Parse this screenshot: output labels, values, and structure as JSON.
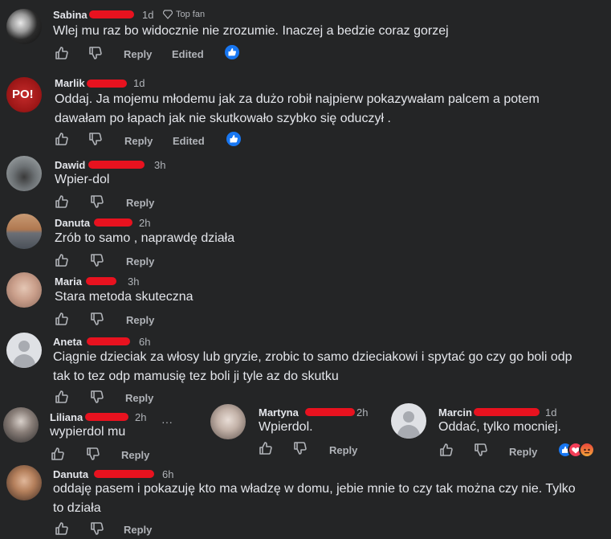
{
  "actions": {
    "reply": "Reply",
    "edited": "Edited",
    "top_fan": "Top fan"
  },
  "comments": [
    {
      "name": "Sabina",
      "time": "1d",
      "text": "Wlej mu raz bo widocznie nie zrozumie. Inaczej a bedzie coraz gorzej"
    },
    {
      "name": "Marlik",
      "time": "1d",
      "text": "Oddaj. Ja mojemu młodemu jak za dużo robił najpierw pokazywałam palcem a potem dawałam po łapach jak nie skutkowało szybko się oduczył ."
    },
    {
      "name": "Dawid",
      "time": "3h",
      "text": "Wpier-dol"
    },
    {
      "name": "Danuta",
      "time": "2h",
      "text": "Zrób to samo , naprawdę działa"
    },
    {
      "name": "Maria",
      "time": "3h",
      "text": "Stara metoda skuteczna"
    },
    {
      "name": "Aneta",
      "time": "6h",
      "text": "Ciągnie dzieciak za włosy lub gryzie, zrobic to samo dzieciakowi i spytać go czy go boli odp tak to tez odp mamusię tez boli ji tyle az do skutku"
    },
    {
      "name": "Liliana",
      "time": "2h",
      "text": "wypierdol mu"
    },
    {
      "name": "Martyna",
      "time": "2h",
      "text": "Wpierdol."
    },
    {
      "name": "Marcin",
      "time": "1d",
      "text": "Oddać, tylko mocniej."
    },
    {
      "name": "Danuta",
      "time": "6h",
      "text": "oddaję pasem i pokazuję kto ma władzę w domu, jebie mnie to czy tak można czy nie. Tylko to działa"
    }
  ],
  "misc": {
    "more": "···",
    "dot": "·",
    "avatar_text": "PO!"
  }
}
